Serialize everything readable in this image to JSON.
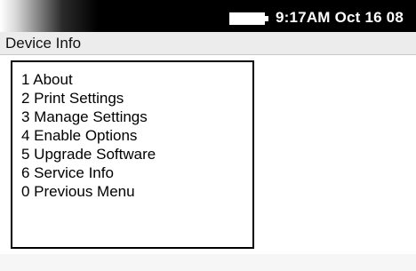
{
  "status_bar": {
    "time_date": "9:17AM Oct 16 08",
    "battery_icon": "battery-icon"
  },
  "title_bar": {
    "title": "Device Info"
  },
  "menu": {
    "items": [
      {
        "label": "1 About"
      },
      {
        "label": "2 Print Settings"
      },
      {
        "label": "3 Manage Settings"
      },
      {
        "label": "4 Enable Options"
      },
      {
        "label": "5 Upgrade Software"
      },
      {
        "label": "6 Service Info"
      },
      {
        "label": "0 Previous Menu"
      }
    ]
  },
  "colors": {
    "status_bar_bg": "#000000",
    "title_bar_bg": "#ececec",
    "text": "#000000"
  }
}
